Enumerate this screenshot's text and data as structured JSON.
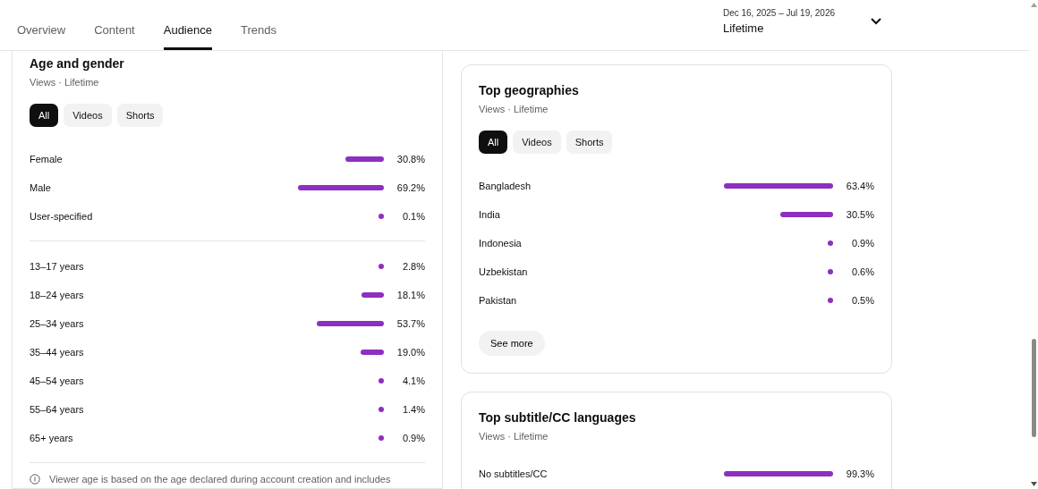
{
  "tabs": [
    {
      "label": "Overview",
      "selected": false
    },
    {
      "label": "Content",
      "selected": false
    },
    {
      "label": "Audience",
      "selected": true
    },
    {
      "label": "Trends",
      "selected": false
    }
  ],
  "date_range": {
    "range": "Dec 16, 2025 – Jul 19, 2026",
    "value": "Lifetime"
  },
  "age_and_gender": {
    "title": "Age and gender",
    "subtitle": "Views · Lifetime",
    "filters": [
      {
        "label": "All",
        "selected": true
      },
      {
        "label": "Videos",
        "selected": false
      },
      {
        "label": "Shorts",
        "selected": false
      }
    ],
    "gender": [
      {
        "label": "Female",
        "value": "30.8%"
      },
      {
        "label": "Male",
        "value": "69.2%"
      },
      {
        "label": "User-specified",
        "value": "0.1%"
      }
    ],
    "age": [
      {
        "label": "13–17 years",
        "value": "2.8%"
      },
      {
        "label": "18–24 years",
        "value": "18.1%"
      },
      {
        "label": "25–34 years",
        "value": "53.7%"
      },
      {
        "label": "35–44 years",
        "value": "19.0%"
      },
      {
        "label": "45–54 years",
        "value": "4.1%"
      },
      {
        "label": "55–64 years",
        "value": "1.4%"
      },
      {
        "label": "65+ years",
        "value": "0.9%"
      }
    ],
    "note": "Viewer age is based on the age declared during account creation and includes"
  },
  "top_geographies": {
    "title": "Top geographies",
    "subtitle": "Views · Lifetime",
    "filters": [
      {
        "label": "All",
        "selected": true
      },
      {
        "label": "Videos",
        "selected": false
      },
      {
        "label": "Shorts",
        "selected": false
      }
    ],
    "rows": [
      {
        "label": "Bangladesh",
        "value": "63.4%"
      },
      {
        "label": "India",
        "value": "30.5%"
      },
      {
        "label": "Indonesia",
        "value": "0.9%"
      },
      {
        "label": "Uzbekistan",
        "value": "0.6%"
      },
      {
        "label": "Pakistan",
        "value": "0.5%"
      }
    ],
    "button": "See more"
  },
  "top_languages": {
    "title": "Top subtitle/CC languages",
    "subtitle": "Views · Lifetime",
    "rows": [
      {
        "label": "No subtitles/CC",
        "value": "99.3%"
      }
    ]
  }
}
